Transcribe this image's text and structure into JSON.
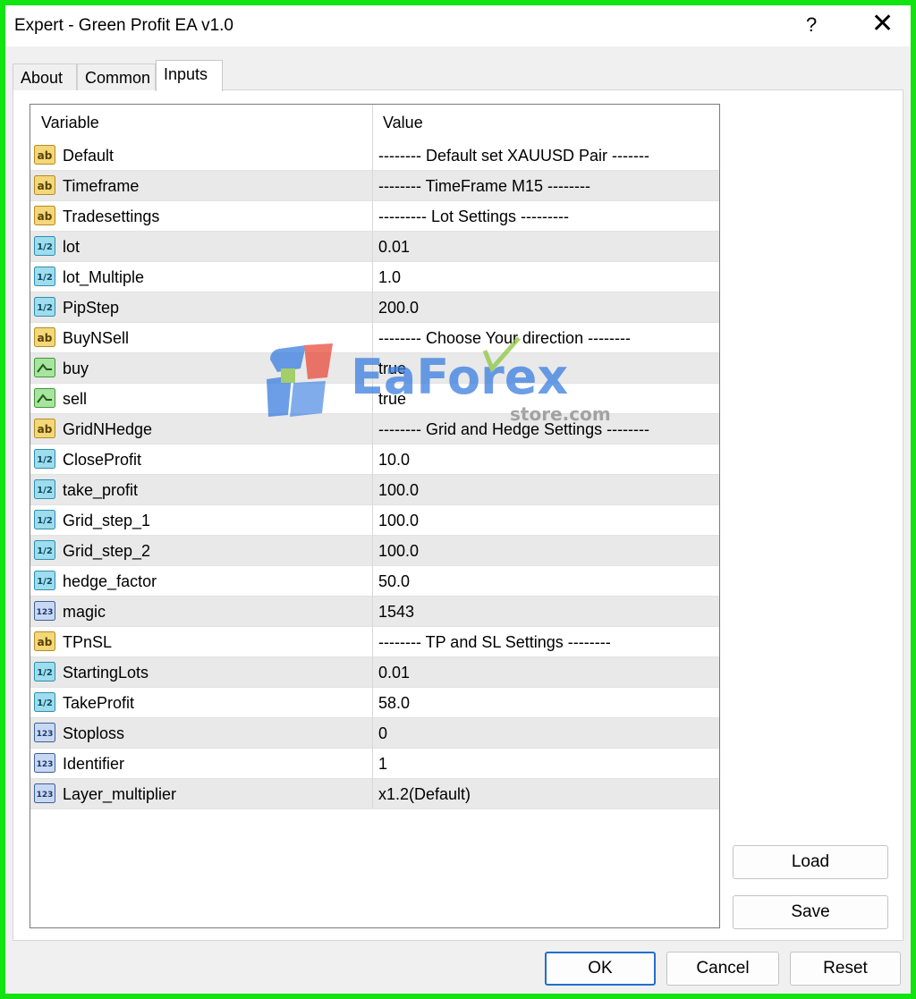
{
  "window": {
    "title": "Expert - Green Profit EA v1.0",
    "help_glyph": "?",
    "close_glyph": "✕"
  },
  "tabs": [
    {
      "label": "About",
      "active": false
    },
    {
      "label": "Common",
      "active": false
    },
    {
      "label": "Inputs",
      "active": true
    }
  ],
  "grid": {
    "headers": {
      "variable": "Variable",
      "value": "Value"
    },
    "rows": [
      {
        "icon": "ab-string-icon",
        "name": "Default",
        "value": "-------- Default set XAUUSD Pair -------"
      },
      {
        "icon": "ab-string-icon",
        "name": "Timeframe",
        "value": "-------- TimeFrame M15 --------"
      },
      {
        "icon": "ab-string-icon",
        "name": "Tradesettings",
        "value": "--------- Lot Settings ---------"
      },
      {
        "icon": "half-double-icon",
        "name": "lot",
        "value": "0.01"
      },
      {
        "icon": "half-double-icon",
        "name": "lot_Multiple",
        "value": "1.0"
      },
      {
        "icon": "half-double-icon",
        "name": "PipStep",
        "value": "200.0"
      },
      {
        "icon": "ab-string-icon",
        "name": "BuyNSell",
        "value": "-------- Choose Your direction --------"
      },
      {
        "icon": "bool-chart-icon",
        "name": "buy",
        "value": "true"
      },
      {
        "icon": "bool-chart-icon",
        "name": "sell",
        "value": "true"
      },
      {
        "icon": "ab-string-icon",
        "name": "GridNHedge",
        "value": "-------- Grid and Hedge Settings --------"
      },
      {
        "icon": "half-double-icon",
        "name": "CloseProfit",
        "value": "10.0"
      },
      {
        "icon": "half-double-icon",
        "name": "take_profit",
        "value": "100.0"
      },
      {
        "icon": "half-double-icon",
        "name": "Grid_step_1",
        "value": "100.0"
      },
      {
        "icon": "half-double-icon",
        "name": "Grid_step_2",
        "value": "100.0"
      },
      {
        "icon": "half-double-icon",
        "name": "hedge_factor",
        "value": "50.0"
      },
      {
        "icon": "int-123-icon",
        "name": "magic",
        "value": "1543"
      },
      {
        "icon": "ab-string-icon",
        "name": "TPnSL",
        "value": "-------- TP and SL Settings --------"
      },
      {
        "icon": "half-double-icon",
        "name": "StartingLots",
        "value": "0.01"
      },
      {
        "icon": "half-double-icon",
        "name": "TakeProfit",
        "value": "58.0"
      },
      {
        "icon": "int-123-icon",
        "name": "Stoploss",
        "value": "0"
      },
      {
        "icon": "int-123-icon",
        "name": "Identifier",
        "value": "1"
      },
      {
        "icon": "int-123-icon",
        "name": "Layer_multiplier",
        "value": "x1.2(Default)"
      }
    ]
  },
  "buttons": {
    "load": "Load",
    "save": "Save",
    "ok": "OK",
    "cancel": "Cancel",
    "reset": "Reset"
  },
  "watermark": {
    "brand": "EaForex",
    "sub": "store.com"
  },
  "colors": {
    "frame_border": "#11e411",
    "alt_row": "#e9e9e9",
    "ok_border": "#1f6fd1",
    "watermark_blue": "#3a7ee0",
    "watermark_green": "#8cc63f"
  }
}
